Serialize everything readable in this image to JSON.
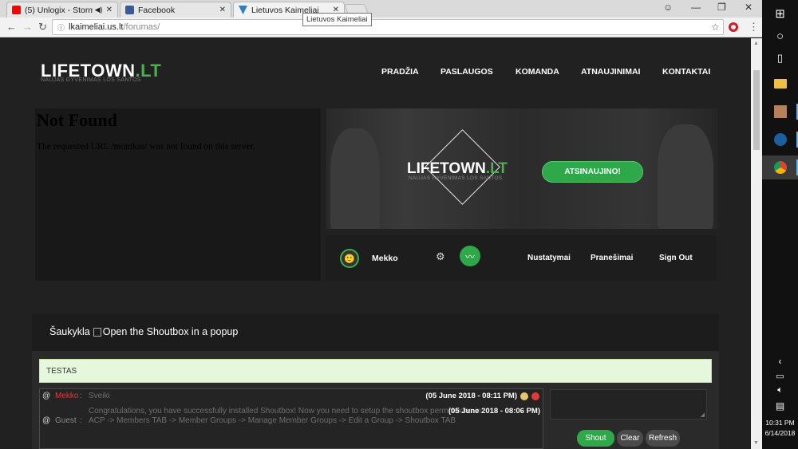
{
  "browser": {
    "tabs": [
      {
        "title": "(5) Unlogix - Storm -",
        "favicon": "youtube-icon",
        "color": "#ff0000"
      },
      {
        "title": "Facebook",
        "favicon": "facebook-icon",
        "color": "#3b5998"
      },
      {
        "title": "Lietuvos Kaimeliai",
        "favicon": "phpbb-icon",
        "color": "#2a7ec4",
        "active": true
      }
    ],
    "tooltip": "Lietuvos Kaimeliai",
    "url_host": "lkaimeliai.us.lt",
    "url_path": "/forumas/"
  },
  "site": {
    "logo_main": "LIFETOWN",
    "logo_suffix": ".LT",
    "logo_sub": "NAUJAS GYVENIMAS LOS SANTOS",
    "nav": [
      "PRADŽIA",
      "PASLAUGOS",
      "KOMANDA",
      "ATNAUJINIMAI",
      "KONTAKTAI"
    ]
  },
  "error": {
    "title": "Not Found",
    "text": "The requested URL /monikas/ was not found on this server."
  },
  "banner": {
    "logo_main": "LIFETOWN",
    "logo_suffix": ".LT",
    "logo_sub": "NAUJAS GYVENIMAS LOS SANTOS",
    "button": "ATSINAUJINO!"
  },
  "user": {
    "name": "Mekko",
    "links": [
      "Nustatymai",
      "Pranešimai",
      "Sign Out"
    ]
  },
  "shoutbox": {
    "title": "Šaukykla",
    "popup_alt": "Open the Shoutbox in a popup",
    "notice": "TESTAS",
    "messages": [
      {
        "user": "Mekko",
        "user_color": "#e53935",
        "text": "Sveiki",
        "date": "(05 June 2018 - 08:11 PM)"
      },
      {
        "user": "Guest",
        "user_color": "#888888",
        "text": "Congratulations, you have successfully installed Shoutbox! Now you need to setup the shoutbox permissions in ACP -> Members TAB -> Member Groups -> Manage Member Groups -> Edit a Group -> Shoutbox TAB",
        "date": "(05 June 2018 - 08:06 PM)"
      }
    ],
    "buttons": {
      "shout": "Shout",
      "clear": "Clear",
      "refresh": "Refresh"
    }
  },
  "taskbar": {
    "time": "10:31 PM",
    "date": "6/14/2018"
  },
  "colors": {
    "accent_green": "#2fa84a",
    "page_bg": "#212121",
    "notice_bg": "#e6f8db"
  }
}
